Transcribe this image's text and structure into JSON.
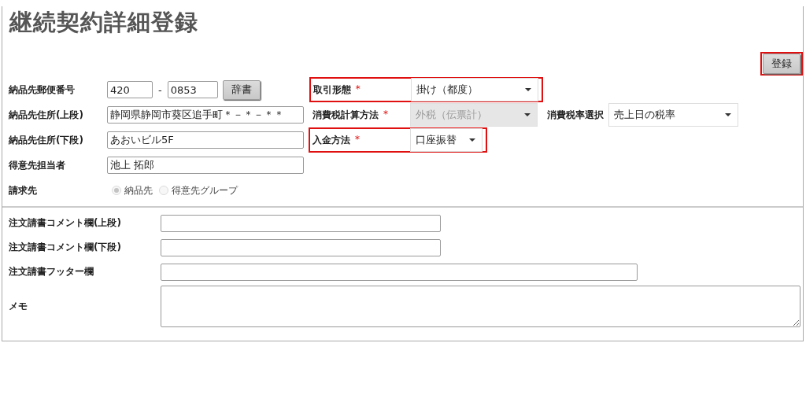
{
  "title": "継続契約詳細登録",
  "required_mark": "*",
  "register_button": {
    "label": "登録",
    "highlighted": true
  },
  "postal_code": {
    "label": "納品先郵便番号",
    "part_1": "420",
    "separator": "-",
    "part_2": "0853",
    "lookup_button": "辞書"
  },
  "address_upper": {
    "label": "納品先住所(上段)",
    "value": "静岡県静岡市葵区追手町＊－＊－＊＊"
  },
  "address_lower": {
    "label": "納品先住所(下段)",
    "value": "あおいビル5F"
  },
  "contact_person": {
    "label": "得意先担当者",
    "value": "池上 拓郎"
  },
  "billing_to": {
    "label": "請求先",
    "options": [
      {
        "label": "納品先",
        "selected": true,
        "disabled": true
      },
      {
        "label": "得意先グループ",
        "selected": false,
        "disabled": true
      }
    ]
  },
  "transaction_type": {
    "label": "取引形態",
    "required": true,
    "value": "掛け（都度）",
    "disabled": false,
    "highlighted": true
  },
  "tax_calculation": {
    "label": "消費税計算方法",
    "required": true,
    "value": "外税（伝票計）",
    "disabled": true,
    "highlighted": false
  },
  "tax_rate": {
    "label": "消費税率選択",
    "value": "売上日の税率",
    "disabled": false
  },
  "payment_method": {
    "label": "入金方法",
    "required": true,
    "value": "口座振替",
    "disabled": false,
    "highlighted": true
  },
  "order_comment_upper": {
    "label": "注文請書コメント欄(上段)"
  },
  "order_comment_lower": {
    "label": "注文請書コメント欄(下段)"
  },
  "order_footer": {
    "label": "注文請書フッター欄"
  },
  "memo": {
    "label": "メモ"
  }
}
